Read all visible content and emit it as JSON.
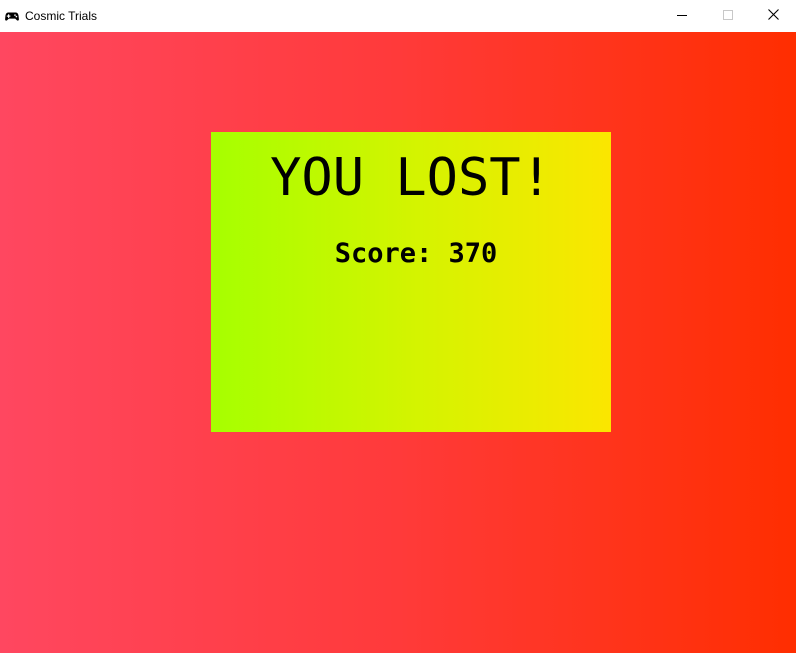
{
  "window": {
    "title": "Cosmic Trials",
    "app_icon": "gamepad-icon",
    "controls": {
      "minimize_icon": "minimize-icon",
      "maximize_icon": "maximize-icon",
      "close_icon": "close-icon"
    }
  },
  "game": {
    "background_colors": [
      "#ff4760",
      "#ff2e00"
    ],
    "panel_colors": [
      "#a6ff00",
      "#fbe600"
    ],
    "result_title": "YOU LOST!",
    "score_label": "Score:",
    "score_value": "370",
    "score_text": "Score: 370"
  }
}
